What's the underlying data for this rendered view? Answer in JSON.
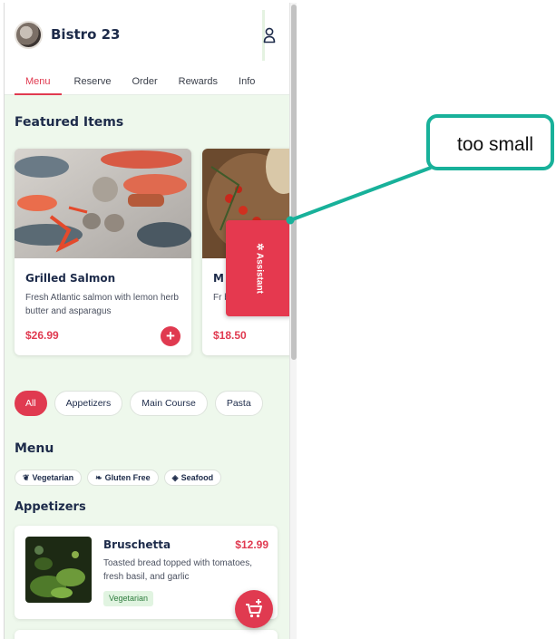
{
  "app": {
    "title": "Bistro 23"
  },
  "tabs": [
    {
      "label": "Menu",
      "active": true
    },
    {
      "label": "Reserve"
    },
    {
      "label": "Order"
    },
    {
      "label": "Rewards"
    },
    {
      "label": "Info"
    }
  ],
  "featured": {
    "title": "Featured Items",
    "items": [
      {
        "name": "Grilled Salmon",
        "description": "Fresh Atlantic salmon with lemon herb butter and asparagus",
        "price": "$26.99"
      },
      {
        "name": "M",
        "description": "Fr ba",
        "price": "$18.50"
      }
    ]
  },
  "assistant": {
    "label": "Assistant"
  },
  "categories": [
    "All",
    "Appetizers",
    "Main Course",
    "Pasta"
  ],
  "menu": {
    "title": "Menu",
    "filters": [
      {
        "label": "Vegetarian",
        "icon": "leaf-icon"
      },
      {
        "label": "Gluten Free",
        "icon": "wheat-icon"
      },
      {
        "label": "Seafood",
        "icon": "fish-icon"
      }
    ],
    "section_title": "Appetizers",
    "items": [
      {
        "name": "Bruschetta",
        "price": "$12.99",
        "description": "Toasted bread topped with tomatoes, fresh basil, and garlic",
        "tag": "Vegetarian"
      }
    ]
  },
  "annotation": {
    "text": "too small"
  },
  "colors": {
    "accent": "#e03a50",
    "navy": "#1d2b4a",
    "background": "#eef8ec",
    "annotation": "#18b19a"
  }
}
